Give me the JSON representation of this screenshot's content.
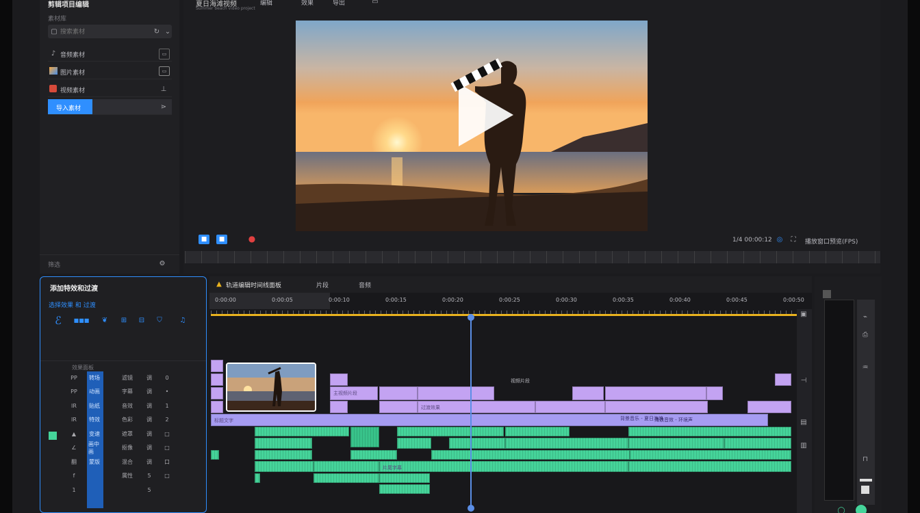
{
  "header": {
    "app_title": "剪辑项目编辑",
    "project_title": "夏日海滩视频",
    "project_subtitle": "Summer beach video project",
    "menu": [
      "编辑",
      "效果",
      "导出"
    ]
  },
  "media_panel": {
    "section_label": "素材库",
    "search": {
      "placeholder": "搜索素材"
    },
    "items": [
      {
        "label": "音频素材",
        "icon": "music-note-icon"
      },
      {
        "label": "图片素材",
        "icon": "image-icon"
      },
      {
        "label": "视频素材",
        "icon": "video-icon"
      }
    ],
    "selected_label": "导入素材",
    "footer_label": "筛选"
  },
  "preview": {
    "timecode": "1/4 00:00:12",
    "status_label": "播放窗口预览(FPS)"
  },
  "effects_panel": {
    "title": "添加特效和过渡",
    "subtitle": "选择效果 和 过渡",
    "grid_label": "效果面板",
    "grid_rows": [
      [
        "PP",
        "转场",
        "滤镜",
        "调",
        "0"
      ],
      [
        "PP",
        "动画",
        "字幕",
        "调",
        "•"
      ],
      [
        "IR",
        "贴纸",
        "音效",
        "调",
        "1"
      ],
      [
        "IR",
        "特效",
        "色彩",
        "调",
        "2"
      ],
      [
        "▲",
        "变速",
        "遮罩",
        "调",
        "□"
      ],
      [
        "∠",
        "画中画",
        "抠像",
        "调",
        "□"
      ],
      [
        "翻",
        "蒙版",
        "混合",
        "调",
        "口"
      ],
      [
        "f",
        "",
        "属性",
        "5",
        "□"
      ],
      [
        "1",
        "",
        "",
        "5",
        ""
      ]
    ]
  },
  "timeline": {
    "tabs": [
      "轨道编辑时间线面板",
      "片段",
      "音频"
    ],
    "ruler_labels": [
      "0:00:00",
      "0:00:05",
      "0:00:10",
      "0:00:15",
      "0:00:20",
      "0:00:25",
      "0:00:30",
      "0:00:35",
      "0:00:40",
      "0:00:45",
      "0:00:50"
    ],
    "track_labels": [
      "视频片段",
      "字幕轨道",
      "背景音乐 - 夏日海浪",
      "海浪音效 - 环境声"
    ],
    "clip_labels": [
      "主视频片段",
      "过渡效果",
      "标题文字",
      "片尾字幕"
    ]
  },
  "colors": {
    "accent": "#2f8fff",
    "clip_purple": "#c3a3f2",
    "clip_lavender": "#a69cf2",
    "clip_green": "#45d49a",
    "playhead": "#5b8ee6",
    "ruler_bar": "#e9b21e"
  }
}
